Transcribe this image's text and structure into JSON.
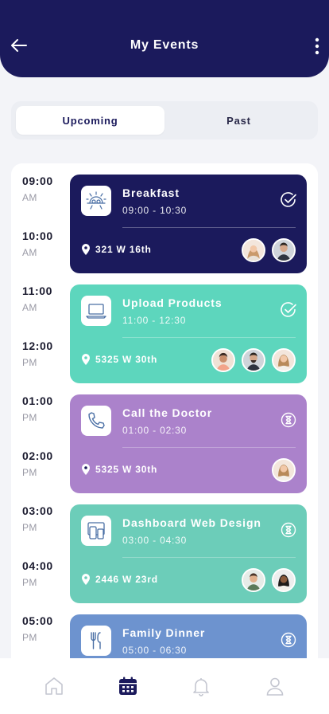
{
  "header": {
    "title": "My Events"
  },
  "tabs": [
    {
      "label": "Upcoming",
      "active": true
    },
    {
      "label": "Past",
      "active": false
    }
  ],
  "timeline": [
    {
      "hour": "09:00",
      "ampm": "AM"
    },
    {
      "hour": "10:00",
      "ampm": "AM"
    },
    {
      "hour": "11:00",
      "ampm": "AM"
    },
    {
      "hour": "12:00",
      "ampm": "PM"
    },
    {
      "hour": "01:00",
      "ampm": "PM"
    },
    {
      "hour": "02:00",
      "ampm": "PM"
    },
    {
      "hour": "03:00",
      "ampm": "PM"
    },
    {
      "hour": "04:00",
      "ampm": "PM"
    },
    {
      "hour": "05:00",
      "ampm": "PM"
    }
  ],
  "events": [
    {
      "title": "Breakfast",
      "time": "09:00 - 10:30",
      "location": "321 W 16th",
      "color": "#1b1a5c",
      "icon": "breakfast-icon",
      "status": "completed",
      "attendees": 2
    },
    {
      "title": "Upload Products",
      "time": "11:00 - 12:30",
      "location": "5325 W 30th",
      "color": "#5dd6bd",
      "icon": "laptop-icon",
      "status": "completed",
      "attendees": 3
    },
    {
      "title": "Call the Doctor",
      "time": "01:00 - 02:30",
      "location": "5325 W 30th",
      "color": "#ab82cb",
      "icon": "phone-icon",
      "status": "pending",
      "attendees": 1
    },
    {
      "title": "Dashboard Web Design",
      "time": "03:00 - 04:30",
      "location": "2446 W 23rd",
      "color": "#6ccdb9",
      "icon": "devices-icon",
      "status": "pending",
      "attendees": 2
    },
    {
      "title": "Family Dinner",
      "time": "05:00 - 06:30",
      "location": "",
      "color": "#6d93cf",
      "icon": "cutlery-icon",
      "status": "pending",
      "attendees": 0
    }
  ],
  "bottom_nav": [
    {
      "name": "home-icon",
      "active": false
    },
    {
      "name": "calendar-icon",
      "active": true
    },
    {
      "name": "bell-icon",
      "active": false
    },
    {
      "name": "profile-icon",
      "active": false
    }
  ],
  "colors": {
    "primary": "#1b1a5c",
    "inactive": "#c4c6d0"
  }
}
